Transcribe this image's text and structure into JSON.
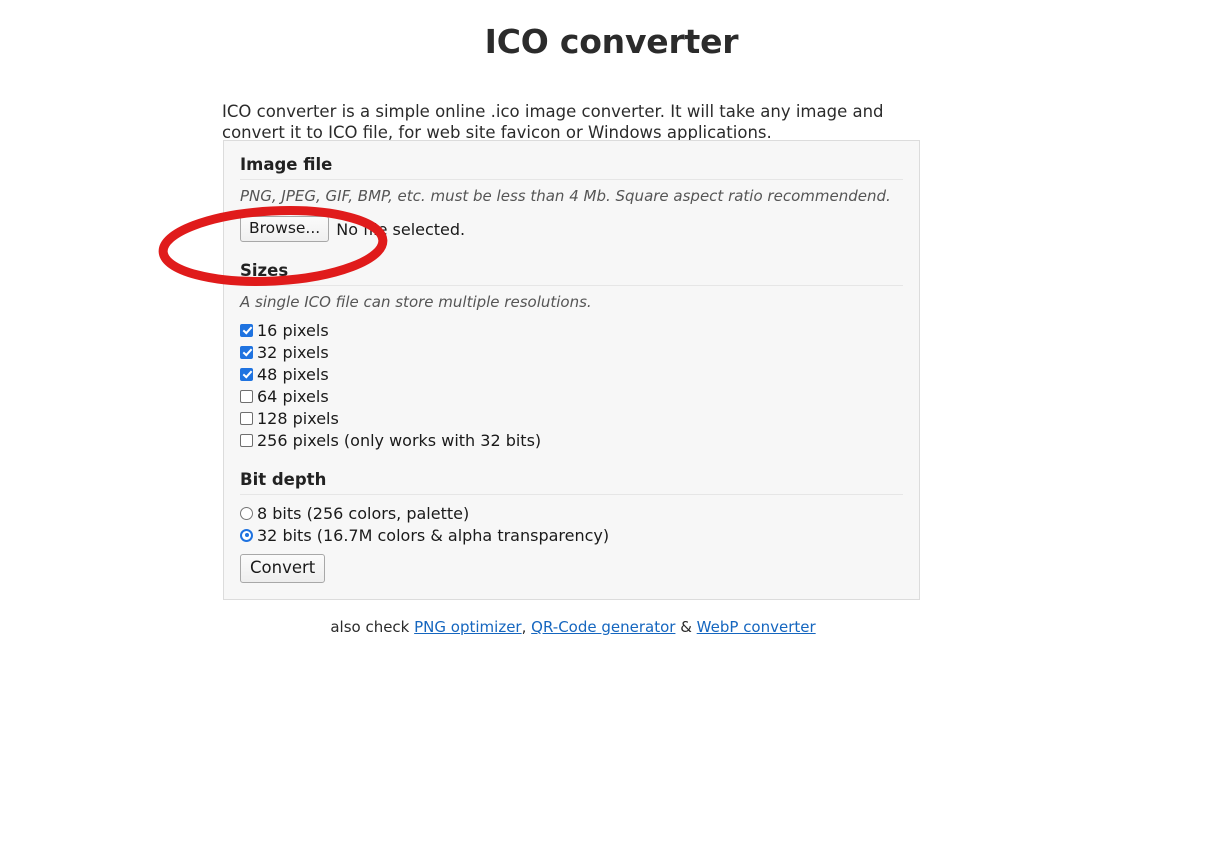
{
  "page": {
    "title": "ICO converter",
    "intro": "ICO converter is a simple online .ico image converter. It will take any image and convert it to ICO file, for web site favicon or Windows applications."
  },
  "form": {
    "image_file": {
      "heading": "Image file",
      "description": "PNG, JPEG, GIF, BMP, etc. must be less than 4 Mb. Square aspect ratio recommendend.",
      "browse_label": "Browse...",
      "file_status": "No file selected."
    },
    "sizes": {
      "heading": "Sizes",
      "description": "A single ICO file can store multiple resolutions.",
      "options": [
        {
          "label": "16 pixels",
          "checked": true
        },
        {
          "label": "32 pixels",
          "checked": true
        },
        {
          "label": "48 pixels",
          "checked": true
        },
        {
          "label": "64 pixels",
          "checked": false
        },
        {
          "label": "128 pixels",
          "checked": false
        },
        {
          "label": "256 pixels (only works with 32 bits)",
          "checked": false
        }
      ]
    },
    "bit_depth": {
      "heading": "Bit depth",
      "options": [
        {
          "label": "8 bits (256 colors, palette)",
          "selected": false
        },
        {
          "label": "32 bits (16.7M colors & alpha transparency)",
          "selected": true
        }
      ]
    },
    "submit_label": "Convert"
  },
  "footer": {
    "prefix": "also check ",
    "links": [
      {
        "label": "PNG optimizer",
        "after": ", "
      },
      {
        "label": "QR-Code generator",
        "after": " & "
      },
      {
        "label": "WebP converter",
        "after": ""
      }
    ]
  },
  "annotation": {
    "shape": "ellipse",
    "color": "#e01b1b",
    "stroke_width": 9
  },
  "colors": {
    "accent": "#1f73e0",
    "link": "#1566bf",
    "panel_bg": "#f7f7f7",
    "panel_border": "#dcdcdc"
  }
}
